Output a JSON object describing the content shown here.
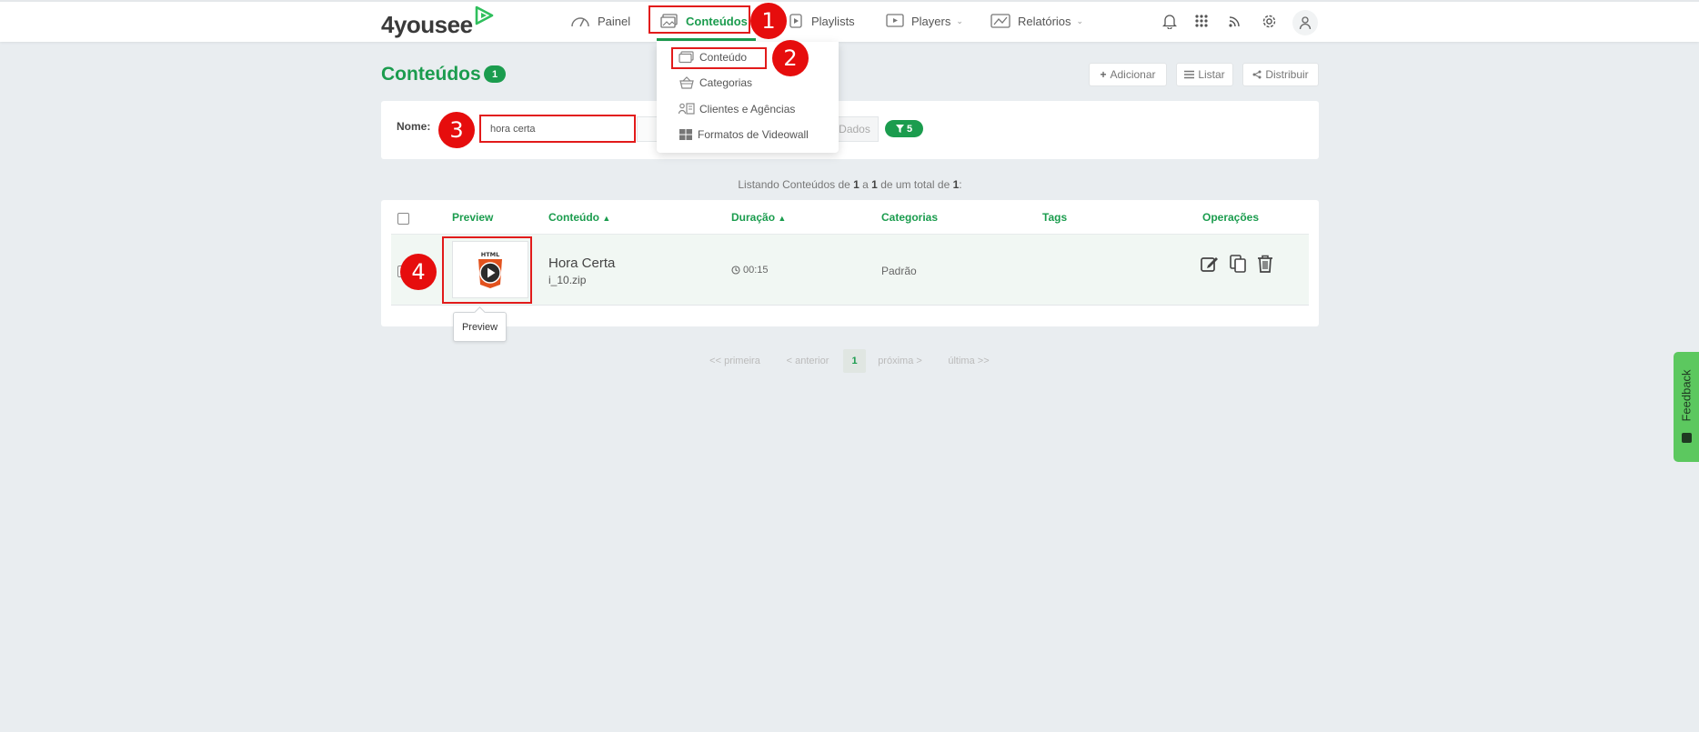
{
  "brand": {
    "logo_text": "4yousee",
    "accent": "#1b9c4e"
  },
  "nav": {
    "items": [
      {
        "label": "Painel",
        "icon": "gauge-icon"
      },
      {
        "label": "Conteúdos",
        "icon": "media-icon",
        "active": true
      },
      {
        "label": "Playlists",
        "icon": "playlist-icon"
      },
      {
        "label": "Players",
        "icon": "player-icon",
        "has_dropdown": true
      },
      {
        "label": "Relatórios",
        "icon": "chart-icon",
        "has_dropdown": true
      }
    ],
    "right_icons": [
      "bell-icon",
      "apps-grid-icon",
      "rss-icon",
      "gear-icon",
      "user-icon"
    ]
  },
  "dropdown": {
    "items": [
      {
        "label": "Conteúdo",
        "icon": "media-icon"
      },
      {
        "label": "Categorias",
        "icon": "basket-icon"
      },
      {
        "label": "Clientes e Agências",
        "icon": "clients-icon"
      },
      {
        "label": "Formatos de Videowall",
        "icon": "grid-icon"
      }
    ]
  },
  "page": {
    "title": "Conteúdos",
    "title_count": "1",
    "actions": {
      "add": "Adicionar",
      "list": "Listar",
      "distribute": "Distribuir"
    }
  },
  "filter": {
    "name_label": "Nome:",
    "name_value": "hora certa",
    "dados_label": "Dados",
    "active_filters": "5"
  },
  "listing": {
    "prefix": "Listando Conteúdos de ",
    "from": "1",
    "mid": " a ",
    "to": "1",
    "mid2": " de um total de ",
    "total": "1",
    "suffix": ":"
  },
  "table": {
    "columns": {
      "preview": "Preview",
      "content": "Conteúdo",
      "duration": "Duração",
      "categories": "Categorias",
      "tags": "Tags",
      "operations": "Operações"
    },
    "rows": [
      {
        "title": "Hora Certa",
        "file": "i_10.zip",
        "duration": "00:15",
        "category": "Padrão",
        "tags": "",
        "thumb_label": "HTML"
      }
    ],
    "tooltip": "Preview"
  },
  "pagination": {
    "first": "<< primeira",
    "prev": "< anterior",
    "current": "1",
    "next": "próxima >",
    "last": "última >>"
  },
  "feedback_label": "Feedback",
  "annotations": [
    "1",
    "2",
    "3",
    "4"
  ]
}
